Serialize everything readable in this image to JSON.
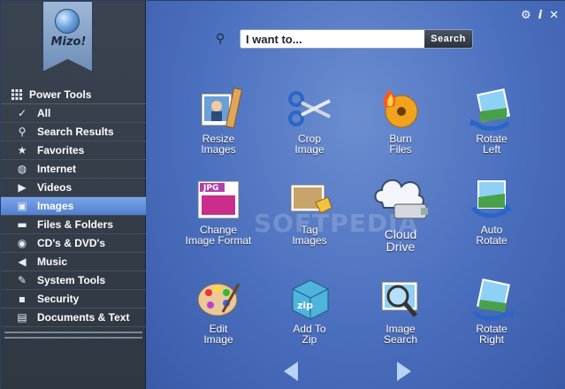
{
  "logo": {
    "text": "Mizo!"
  },
  "sidebar": {
    "header": {
      "label": "Power Tools",
      "icon": "grid-icon"
    },
    "items": [
      {
        "label": "All",
        "icon": "check-icon",
        "glyph": "✓",
        "selected": false
      },
      {
        "label": "Search Results",
        "icon": "search-icon",
        "glyph": "⚲",
        "selected": false
      },
      {
        "label": "Favorites",
        "icon": "star-icon",
        "glyph": "★",
        "selected": false
      },
      {
        "label": "Internet",
        "icon": "globe-icon",
        "glyph": "◍",
        "selected": false
      },
      {
        "label": "Videos",
        "icon": "video-camera-icon",
        "glyph": "▶",
        "selected": false
      },
      {
        "label": "Images",
        "icon": "image-icon",
        "glyph": "▣",
        "selected": true
      },
      {
        "label": "Files & Folders",
        "icon": "folder-icon",
        "glyph": "▬",
        "selected": false
      },
      {
        "label": "CD's & DVD's",
        "icon": "disc-icon",
        "glyph": "◉",
        "selected": false
      },
      {
        "label": "Music",
        "icon": "speaker-icon",
        "glyph": "◀",
        "selected": false
      },
      {
        "label": "System Tools",
        "icon": "wrench-icon",
        "glyph": "✎",
        "selected": false
      },
      {
        "label": "Security",
        "icon": "lock-icon",
        "glyph": "▪",
        "selected": false
      },
      {
        "label": "Documents & Text",
        "icon": "document-icon",
        "glyph": "▤",
        "selected": false
      }
    ]
  },
  "topbar": {
    "settings_icon": "gear-icon",
    "info_icon": "info-icon",
    "close_icon": "close-icon"
  },
  "search": {
    "placeholder": "I want to...",
    "button_label": "Search"
  },
  "tools": [
    {
      "id": "resize-images",
      "label": "Resize\nImages",
      "icon": "resize-images-icon"
    },
    {
      "id": "crop-image",
      "label": "Crop\nImage",
      "icon": "scissors-icon"
    },
    {
      "id": "burn-files",
      "label": "Burn\nFiles",
      "icon": "burn-disc-icon"
    },
    {
      "id": "rotate-left",
      "label": "Rotate\nLeft",
      "icon": "rotate-left-icon"
    },
    {
      "id": "change-image-format",
      "label": "Change\nImage Format",
      "icon": "jpg-format-icon"
    },
    {
      "id": "tag-images",
      "label": "Tag\nImages",
      "icon": "tag-image-icon"
    },
    {
      "id": "cloud-drive",
      "label": "Cloud\nDrive",
      "icon": "cloud-drive-icon"
    },
    {
      "id": "auto-rotate",
      "label": "Auto\nRotate",
      "icon": "auto-rotate-icon"
    },
    {
      "id": "edit-image",
      "label": "Edit\nImage",
      "icon": "paint-palette-icon"
    },
    {
      "id": "add-to-zip",
      "label": "Add To\nZip",
      "icon": "zip-box-icon"
    },
    {
      "id": "image-search",
      "label": "Image\nSearch",
      "icon": "magnifier-image-icon"
    },
    {
      "id": "rotate-right",
      "label": "Rotate\nRight",
      "icon": "rotate-right-icon"
    }
  ],
  "pager": {
    "prev_icon": "arrow-left-icon",
    "next_icon": "arrow-right-icon"
  },
  "watermark": "SOFTPEDIA"
}
